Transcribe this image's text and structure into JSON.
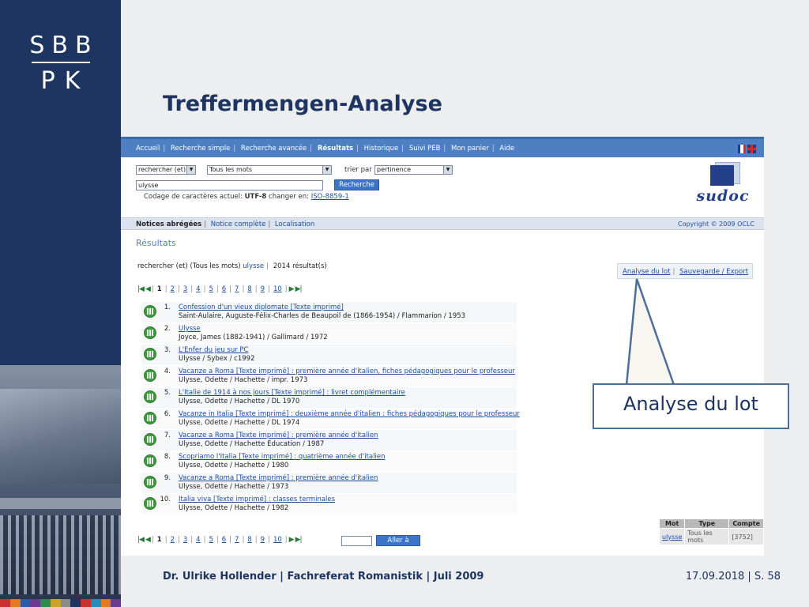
{
  "logo": {
    "line1": "SBB",
    "line2": "PK"
  },
  "slide_title": "Treffermengen-Analyse",
  "topnav": [
    {
      "label": "Accueil"
    },
    {
      "label": "Recherche simple"
    },
    {
      "label": "Recherche avancée"
    },
    {
      "label": "Résultats"
    },
    {
      "label": "Historique"
    },
    {
      "label": "Suivi PEB"
    },
    {
      "label": "Mon panier"
    },
    {
      "label": "Aide"
    }
  ],
  "search": {
    "mode_value": "rechercher (et)",
    "field_value": "Tous les mots",
    "sort_label": "trier par",
    "sort_value": "pertinence",
    "query_value": "ulysse",
    "button_label": "Recherche",
    "encoding_text": "Codage de caractères actuel:",
    "encoding_value": "UTF-8",
    "encoding_change": "changer en:",
    "encoding_alt": "ISO-8859-1"
  },
  "sudoc_logo": "sudoc",
  "subnav": [
    {
      "label": "Notices abrégées"
    },
    {
      "label": "Notice complète"
    },
    {
      "label": "Localisation"
    }
  ],
  "copyright": "Copyright © 2009 OCLC",
  "results_heading": "Résultats",
  "summary": {
    "query": "rechercher (et) (Tous les mots)",
    "keyword": "ulysse",
    "count": "2014 résultat(s)"
  },
  "actions": {
    "analyse": "Analyse du lot",
    "export": "Sauvegarde / Export"
  },
  "pages": [
    "1",
    "2",
    "3",
    "4",
    "5",
    "6",
    "7",
    "8",
    "9",
    "10"
  ],
  "results": [
    {
      "num": "1.",
      "title": "Confession d'un vieux diplomate [Texte imprimé]",
      "detail": "Saint-Aulaire, Auguste-Félix-Charles de Beaupoil de (1866-1954) / Flammarion / 1953"
    },
    {
      "num": "2.",
      "title": "Ulysse",
      "detail": "Joyce, James (1882-1941) / Gallimard / 1972"
    },
    {
      "num": "3.",
      "title": "L'Enfer du jeu sur PC",
      "detail": "Ulysse / Sybex / c1992"
    },
    {
      "num": "4.",
      "title": "Vacanze a Roma [Texte imprimé] : première année d'italien, fiches pédagogiques pour le professeur",
      "detail": "Ulysse, Odette / Hachette / impr. 1973"
    },
    {
      "num": "5.",
      "title": "L'Italie de 1914 à nos jours [Texte imprimé] : livret complémentaire",
      "detail": "Ulysse, Odette / Hachette / DL 1970"
    },
    {
      "num": "6.",
      "title": "Vacanze in Italia [Texte imprimé] : deuxième année d'italien : fiches pédagogiques pour le professeur",
      "detail": "Ulysse, Odette / Hachette / DL 1974"
    },
    {
      "num": "7.",
      "title": "Vacanze a Roma [Texte imprimé] : première année d'italien",
      "detail": "Ulysse, Odette / Hachette Éducation / 1987"
    },
    {
      "num": "8.",
      "title": "Scopriamo l'Italia [Texte imprimé] : quatrième année d'italien",
      "detail": "Ulysse, Odette / Hachette / 1980"
    },
    {
      "num": "9.",
      "title": "Vacanze a Roma [Texte imprimé] : première année d'italien",
      "detail": "Ulysse, Odette / Hachette / 1973"
    },
    {
      "num": "10.",
      "title": "Italia viva [Texte imprimé] : classes terminales",
      "detail": "Ulysse, Odette / Hachette / 1982"
    }
  ],
  "goto_button": "Aller à",
  "word_table": {
    "headers": [
      "Mot",
      "Type",
      "Compte"
    ],
    "row": [
      "ulysse",
      "Tous les mots",
      "[3752]"
    ]
  },
  "callout": "Analyse du lot",
  "footer": {
    "left": "Dr. Ulrike Hollender | Fachreferat Romanistik | Juli 2009",
    "right": "17.09.2018 | S. 58"
  },
  "colors": {
    "navy": "#1e3461",
    "topbar": "#4f7fc3",
    "link": "#1c4fa0",
    "green_icon": "#3f9a3f"
  }
}
